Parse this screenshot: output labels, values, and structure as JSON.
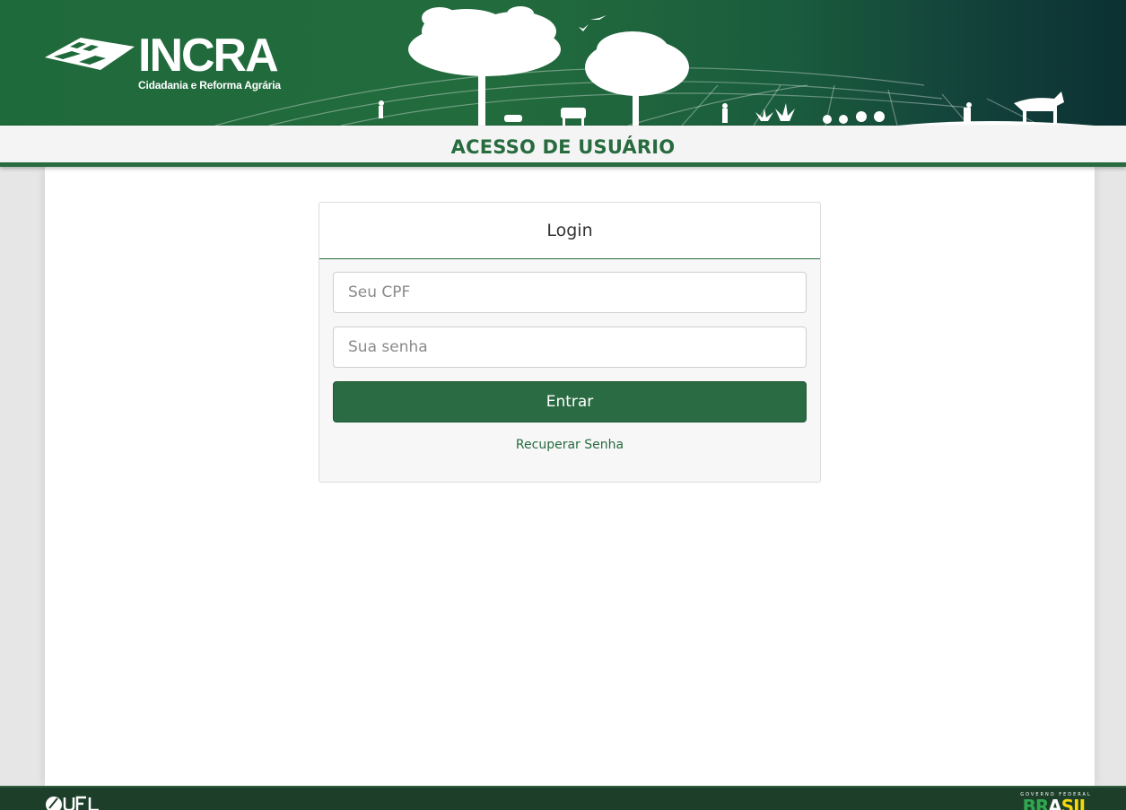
{
  "header": {
    "logo_title": "INCRA",
    "logo_subtitle": "Cidadania e Reforma Agrária",
    "page_title": "ACESSO DE USUÁRIO"
  },
  "login": {
    "heading": "Login",
    "cpf_placeholder": "Seu CPF",
    "password_placeholder": "Sua senha",
    "submit_label": "Entrar",
    "recover_label": "Recuperar Senha"
  },
  "footer": {
    "left_logo": "UFLA",
    "gov_label": "GOVERNO FEDERAL",
    "brasil_a": "BR",
    "brasil_b": "A",
    "brasil_c": "SIL"
  },
  "colors": {
    "brand_green": "#276b3f",
    "button_green": "#2a6b43",
    "footer_green": "#1d3f2a"
  }
}
